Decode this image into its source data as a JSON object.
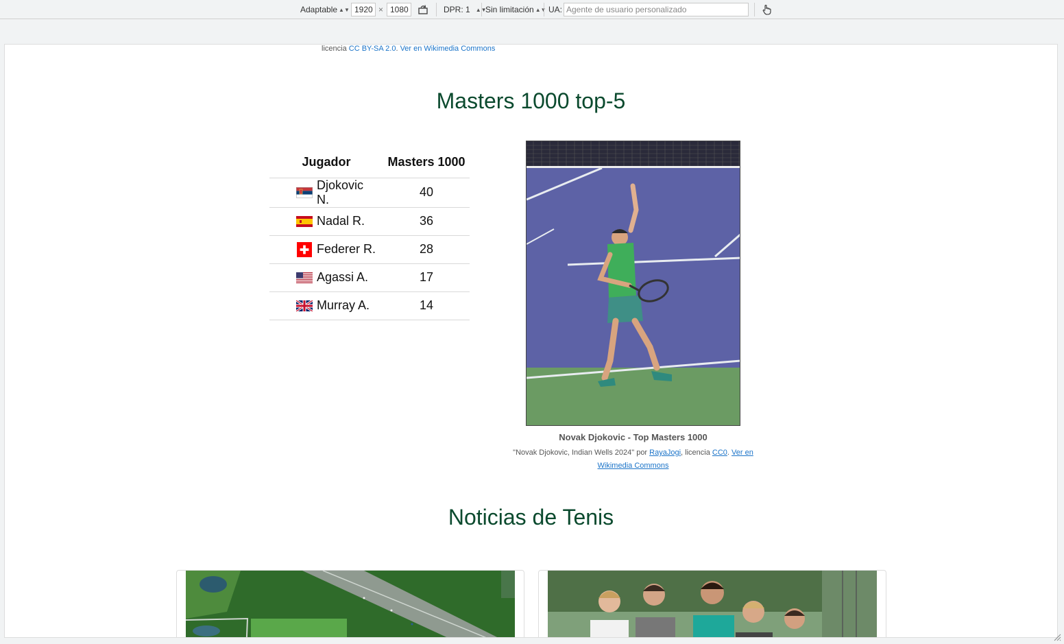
{
  "devtools": {
    "device": "Adaptable",
    "width": "1920",
    "times": "×",
    "height": "1080",
    "dpr": "DPR: 1",
    "throttle": "Sin limitación",
    "ua_label": "UA:",
    "ua_placeholder": "Agente de usuario personalizado"
  },
  "top_credit": {
    "prefix": "licencia ",
    "license": "CC BY-SA 2.0",
    "sep": ". ",
    "view_link": "Ver en Wikimedia Commons"
  },
  "masters": {
    "title": "Masters 1000 top-5",
    "headers": [
      "Jugador",
      "Masters 1000"
    ],
    "rows": [
      {
        "player": "Djokovic N.",
        "titles": "40",
        "flag": "serbia"
      },
      {
        "player": "Nadal R.",
        "titles": "36",
        "flag": "spain"
      },
      {
        "player": "Federer R.",
        "titles": "28",
        "flag": "switzerland"
      },
      {
        "player": "Agassi A.",
        "titles": "17",
        "flag": "usa"
      },
      {
        "player": "Murray A.",
        "titles": "14",
        "flag": "uk"
      }
    ]
  },
  "figure": {
    "caption": "Novak Djokovic - Top Masters 1000",
    "credit_prefix": "\"Novak Djokovic, Indian Wells 2024\" por ",
    "author": "RayaJogi",
    "credit_mid": ", licencia ",
    "license": "CC0",
    "credit_sep": ". ",
    "view_link_1": "Ver en",
    "view_link_2": "Wikimedia Commons"
  },
  "news": {
    "title": "Noticias de Tenis"
  },
  "colors": {
    "heading": "#0b4a2e",
    "link": "#1a73c8"
  }
}
